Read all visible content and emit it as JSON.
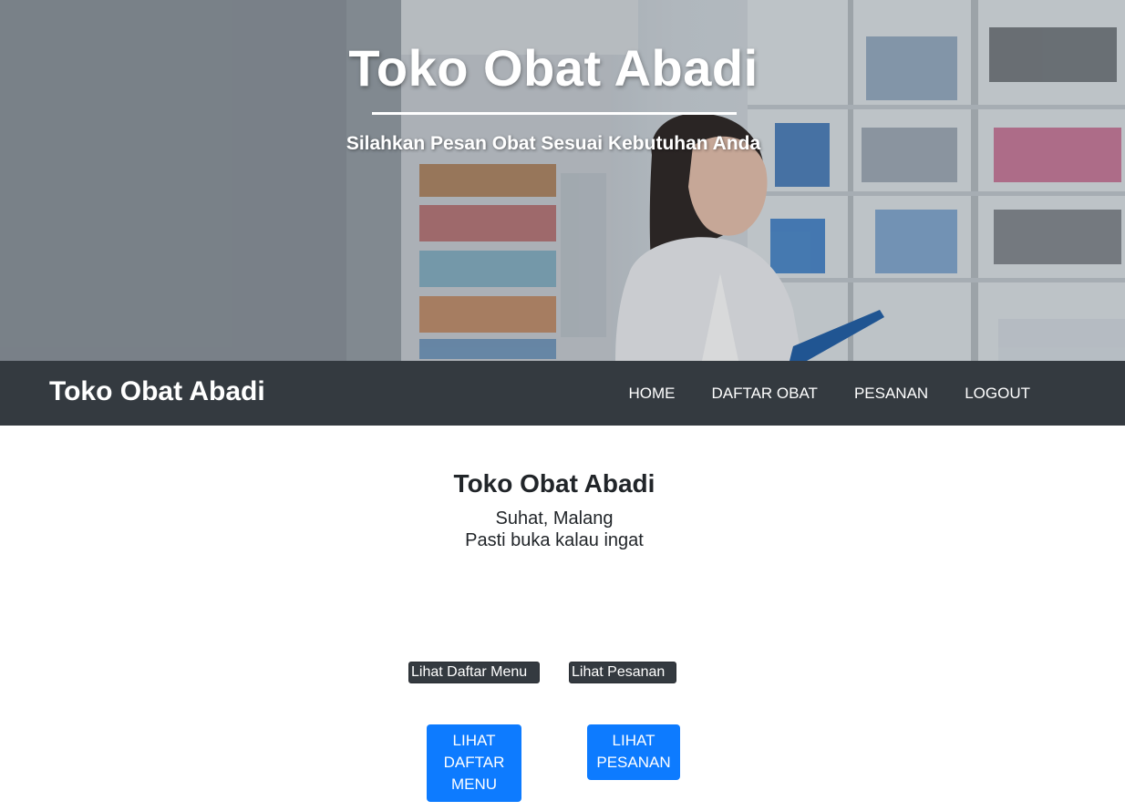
{
  "hero": {
    "title": "Toko Obat Abadi",
    "subtitle": "Silahkan Pesan Obat Sesuai Kebutuhan Anda",
    "background": "pharmacist-woman-with-clipboard-in-pharmacy-aisle"
  },
  "navbar": {
    "brand": "Toko Obat Abadi",
    "links": [
      "HOME",
      "DAFTAR OBAT",
      "PESANAN",
      "LOGOUT"
    ],
    "background": "#343a40"
  },
  "content": {
    "title": "Toko Obat Abadi",
    "address": "Suhat, Malang",
    "tagline": "Pasti buka kalau ingat"
  },
  "images": {
    "menu_alt": "Lihat Daftar Menu",
    "pesanan_alt": "Lihat Pesanan"
  },
  "buttons": {
    "menu_lines": [
      "LIHAT",
      "DAFTAR",
      "MENU"
    ],
    "pesanan_lines": [
      "LIHAT",
      "PESANAN"
    ],
    "color": "#0d7bff"
  }
}
